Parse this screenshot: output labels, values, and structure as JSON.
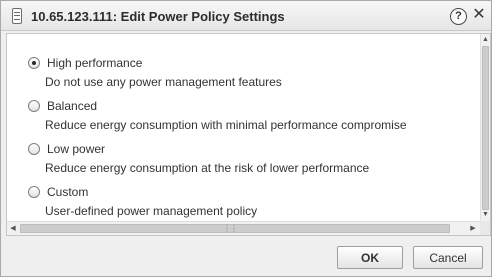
{
  "window": {
    "title": "10.65.123.111: Edit Power Policy Settings",
    "icon": "host-icon",
    "help_glyph": "?",
    "close_glyph": "✕"
  },
  "policies": [
    {
      "label": "High performance",
      "description": "Do not use any power management features",
      "selected": true
    },
    {
      "label": "Balanced",
      "description": "Reduce energy consumption with minimal performance compromise",
      "selected": false
    },
    {
      "label": "Low power",
      "description": "Reduce energy consumption at the risk of lower performance",
      "selected": false
    },
    {
      "label": "Custom",
      "description": "User-defined power management policy",
      "selected": false
    }
  ],
  "buttons": {
    "ok_label": "OK",
    "cancel_label": "Cancel"
  }
}
